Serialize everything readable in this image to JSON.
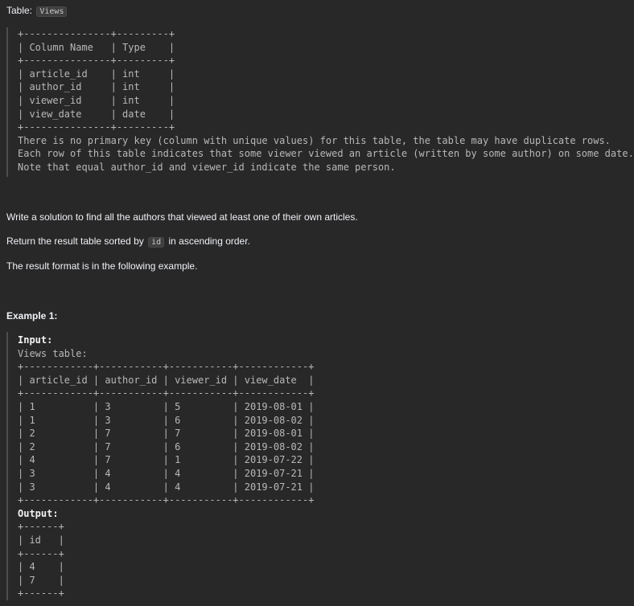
{
  "table_label": "Table:",
  "table_name": "Views",
  "schema_block": "+---------------+---------+\n| Column Name   | Type    |\n+---------------+---------+\n| article_id    | int     |\n| author_id     | int     |\n| viewer_id     | int     |\n| view_date     | date    |\n+---------------+---------+\nThere is no primary key (column with unique values) for this table, the table may have duplicate rows.\nEach row of this table indicates that some viewer viewed an article (written by some author) on some date.\nNote that equal author_id and viewer_id indicate the same person.",
  "task": "Write a solution to find all the authors that viewed at least one of their own articles.",
  "return_prefix": "Return the result table sorted by",
  "return_code": "id",
  "return_suffix": "in ascending order.",
  "format_note": "The result format is in the following example.",
  "example_heading": "Example 1:",
  "input_label": "Input:",
  "input_table_caption": "Views table:",
  "input_table": "+------------+-----------+-----------+------------+\n| article_id | author_id | viewer_id | view_date  |\n+------------+-----------+-----------+------------+\n| 1          | 3         | 5         | 2019-08-01 |\n| 1          | 3         | 6         | 2019-08-02 |\n| 2          | 7         | 7         | 2019-08-01 |\n| 2          | 7         | 6         | 2019-08-02 |\n| 4          | 7         | 1         | 2019-07-22 |\n| 3          | 4         | 4         | 2019-07-21 |\n| 3          | 4         | 4         | 2019-07-21 |\n+------------+-----------+-----------+------------+",
  "output_label": "Output:",
  "output_table": "+------+\n| id   |\n+------+\n| 4    |\n| 7    |\n+------+"
}
